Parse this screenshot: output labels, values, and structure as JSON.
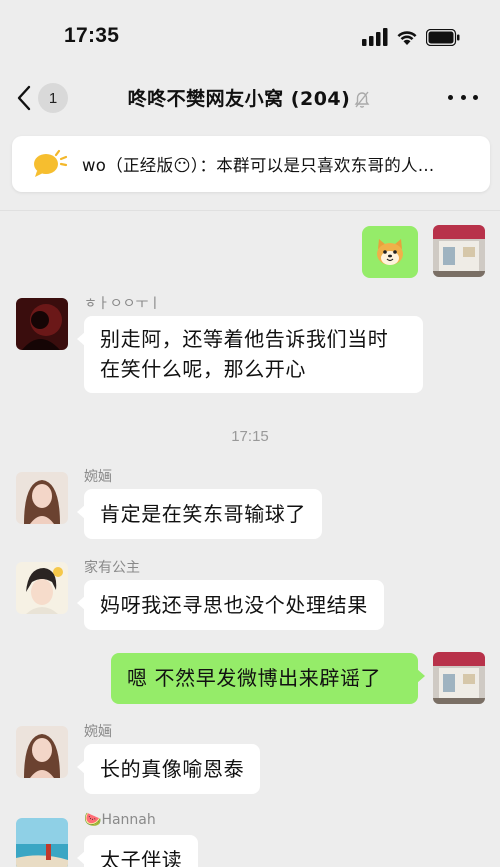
{
  "status_bar": {
    "time": "17:35"
  },
  "nav": {
    "back_count": "1",
    "title": "咚咚不樊网友小窝 (204)"
  },
  "pinned": {
    "text": "wo（正经版😶）：本群可以是只喜欢东哥的人..."
  },
  "messages": [
    {
      "sender": "ㅎㅏㅇㅇㅜㅣ",
      "lines": [
        "别走阿，还等着他告诉我们当时",
        "在笑什么呢，那么开心"
      ]
    },
    {
      "sender": "婉婳",
      "text": "肯定是在笑东哥输球了"
    },
    {
      "sender": "家有公主",
      "text": "妈呀我还寻思也没个处理结果"
    },
    {
      "text": "嗯 不然早发微博出来辟谣了"
    },
    {
      "sender": "婉婳",
      "text": "长的真像喻恩泰"
    },
    {
      "sender": "Hannah",
      "sender_emoji": "🍉",
      "text": "太子伴读"
    }
  ],
  "timestamp": "17:15",
  "colors": {
    "outgoing_bubble": "#95ec69",
    "incoming_bubble": "#ffffff",
    "background": "#ededed"
  }
}
